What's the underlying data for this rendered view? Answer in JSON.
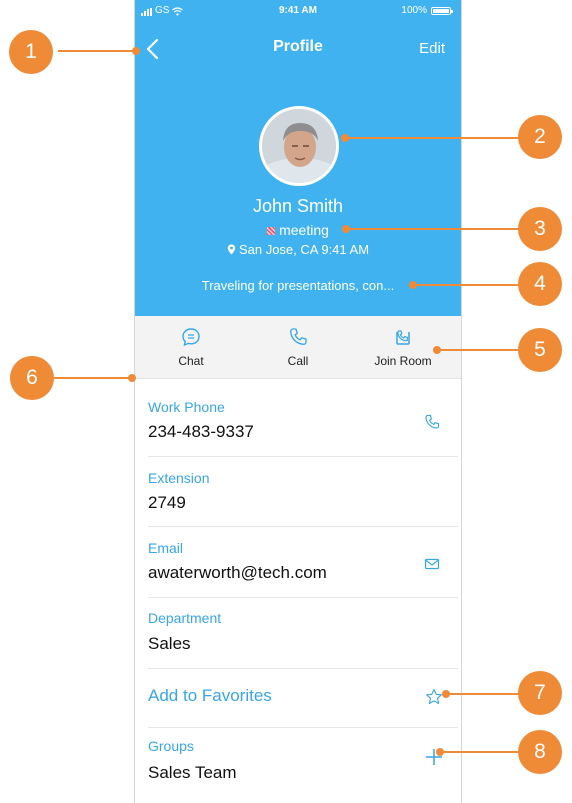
{
  "status_bar": {
    "carrier": "GS",
    "time": "9:41 AM",
    "battery": "100%",
    "battery_level": 1.0
  },
  "nav": {
    "title": "Profile",
    "edit_label": "Edit"
  },
  "profile": {
    "name": "John Smith",
    "presence": "meeting",
    "location": "San Jose, CA 9:41 AM",
    "status_message": "Traveling for presentations, con..."
  },
  "actions": [
    {
      "label": "Chat",
      "icon": "chat-bubble-icon"
    },
    {
      "label": "Call",
      "icon": "phone-icon"
    },
    {
      "label": "Join Room",
      "icon": "join-room-icon"
    }
  ],
  "details": {
    "work_phone": {
      "label": "Work Phone",
      "value": "234-483-9337",
      "icon": "phone-icon"
    },
    "extension": {
      "label": "Extension",
      "value": "2749"
    },
    "email": {
      "label": "Email",
      "value": "awaterworth@tech.com",
      "icon": "mail-icon"
    },
    "department": {
      "label": "Department",
      "value": "Sales"
    },
    "favorites": {
      "label": "Add to Favorites",
      "icon": "star-icon"
    },
    "groups": {
      "label": "Groups",
      "value": "Sales Team",
      "icon": "plus-icon"
    }
  },
  "callouts": [
    "1",
    "2",
    "3",
    "4",
    "5",
    "6",
    "7",
    "8"
  ],
  "colors": {
    "header_bg": "#40b2f0",
    "accent": "#37a6e6",
    "callout": "#ef8a36",
    "action_bar_bg": "#f3f3f3"
  }
}
